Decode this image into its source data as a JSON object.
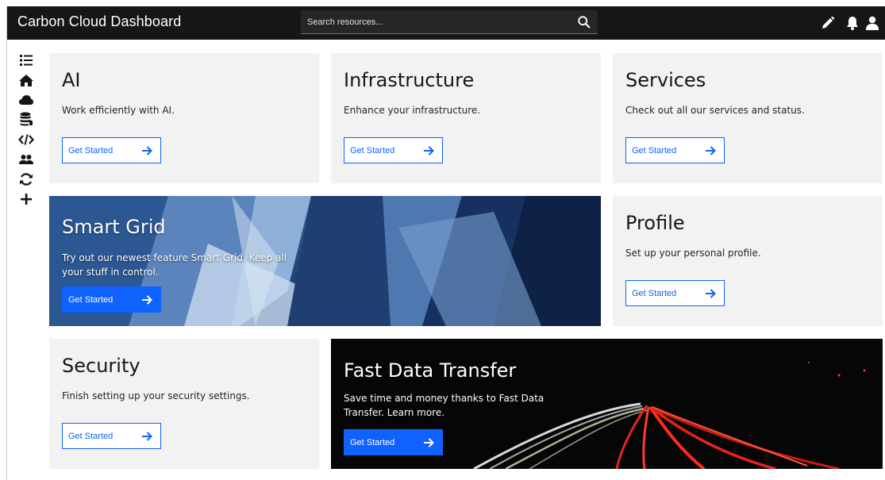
{
  "header": {
    "title": "Carbon Cloud Dashboard",
    "search_placeholder": "Search resources...",
    "icons": [
      "edit-icon",
      "notification-icon",
      "user-icon"
    ]
  },
  "sidebar": {
    "icons": [
      "list-icon",
      "home-icon",
      "cloud-icon",
      "database-icon",
      "code-icon",
      "users-icon",
      "sync-icon",
      "add-icon"
    ]
  },
  "cards": {
    "ai": {
      "title": "AI",
      "description": "Work efficiently with AI.",
      "button": "Get Started"
    },
    "infrastructure": {
      "title": "Infrastructure",
      "description": "Enhance your infrastructure.",
      "button": "Get Started"
    },
    "services": {
      "title": "Services",
      "description": "Check out all our services and status.",
      "button": "Get Started"
    },
    "smart_grid": {
      "title": "Smart Grid",
      "description": "Try out our newest feature Smart Grid. Keep all your stuff in control.",
      "button": "Get Started"
    },
    "profile": {
      "title": "Profile",
      "description": "Set up your personal profile.",
      "button": "Get Started"
    },
    "security": {
      "title": "Security",
      "description": "Finish setting up your security settings.",
      "button": "Get Started"
    },
    "fast_data": {
      "title": "Fast Data Transfer",
      "description": "Save time and money thanks to Fast Data Transfer. Learn more.",
      "button": "Get Started"
    }
  },
  "colors": {
    "header_bg": "#161616",
    "card_bg": "#f2f2f2",
    "accent": "#0f62fe"
  }
}
